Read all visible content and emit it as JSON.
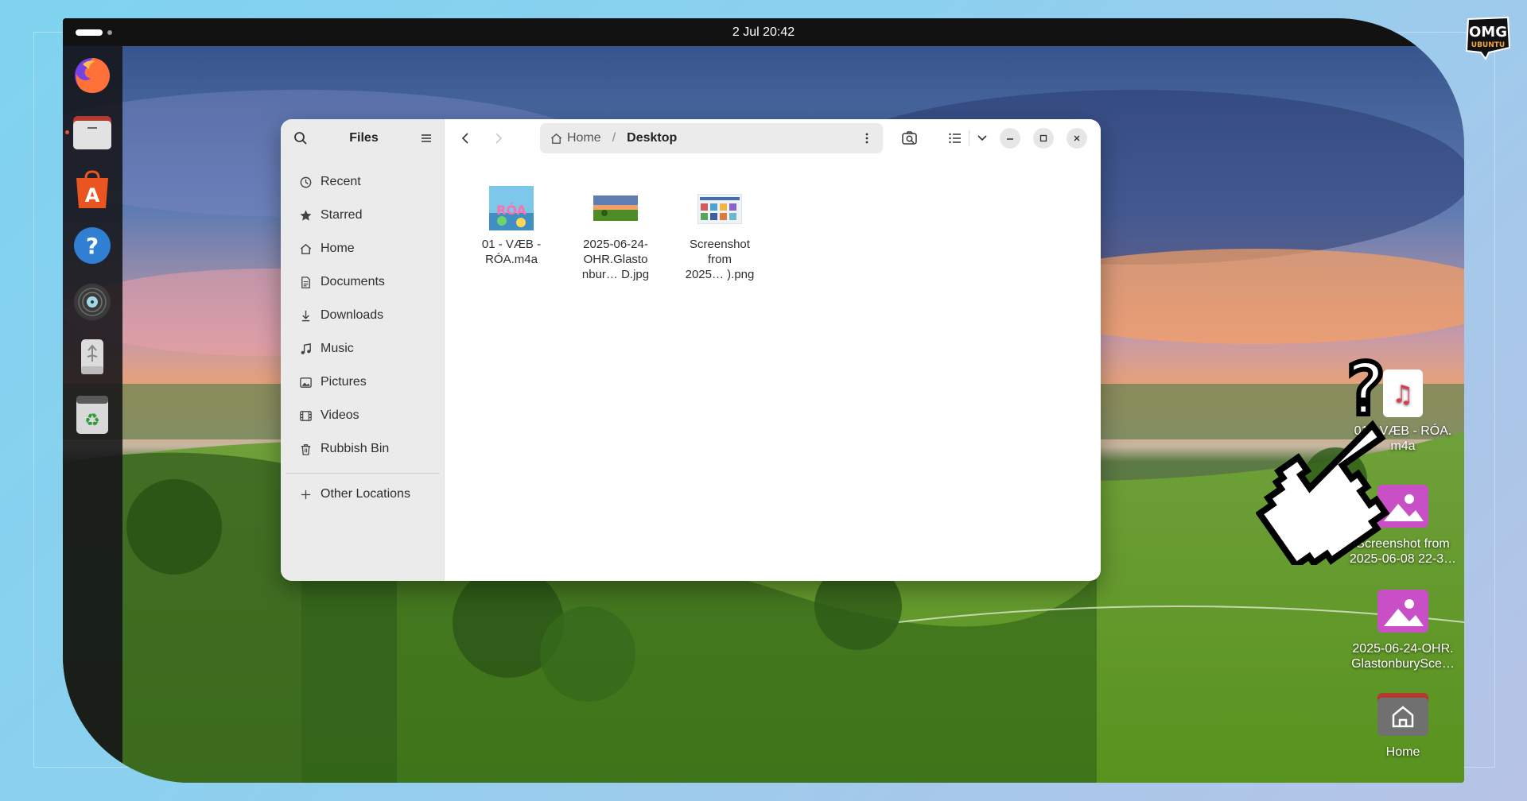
{
  "topbar": {
    "clock": "2 Jul  20:42"
  },
  "dock": {
    "items": [
      {
        "name": "firefox"
      },
      {
        "name": "files",
        "running": true
      },
      {
        "name": "app-center"
      },
      {
        "name": "help"
      },
      {
        "name": "rhythmbox"
      },
      {
        "name": "usb-drive"
      },
      {
        "name": "trash"
      }
    ]
  },
  "files_window": {
    "title": "Files",
    "sidebar": {
      "items": [
        {
          "label": "Recent",
          "icon": "clock-icon"
        },
        {
          "label": "Starred",
          "icon": "star-icon"
        },
        {
          "label": "Home",
          "icon": "home-icon"
        },
        {
          "label": "Documents",
          "icon": "document-icon"
        },
        {
          "label": "Downloads",
          "icon": "download-icon"
        },
        {
          "label": "Music",
          "icon": "music-icon"
        },
        {
          "label": "Pictures",
          "icon": "pictures-icon"
        },
        {
          "label": "Videos",
          "icon": "video-icon"
        },
        {
          "label": "Rubbish Bin",
          "icon": "trash-icon"
        }
      ],
      "other_locations": "Other Locations"
    },
    "path": {
      "home": "Home",
      "separator": "/",
      "current": "Desktop"
    },
    "files": [
      {
        "name": "01 - VÆB - RÓA.m4a",
        "line1": "01 - VÆB -",
        "line2": "RÓA.m4a",
        "line3": ""
      },
      {
        "name": "2025-06-24-OHR.Glastonbur… D.jpg",
        "line1": "2025-06-24-",
        "line2": "OHR.Glasto",
        "line3": "nbur… D.jpg"
      },
      {
        "name": "Screenshot from 2025… ).png",
        "line1": "Screenshot",
        "line2": "from",
        "line3": "2025… ).png"
      }
    ]
  },
  "desktop": {
    "icons": [
      {
        "line1": "01 - VÆB - RÓA.",
        "line2": "m4a",
        "type": "audio"
      },
      {
        "line1": "Screenshot from",
        "line2": "2025-06-08 22-3…",
        "type": "image"
      },
      {
        "line1": "2025-06-24-OHR.",
        "line2": "GlastonburySce…",
        "type": "image"
      },
      {
        "line1": "Home",
        "line2": "",
        "type": "folder"
      }
    ]
  },
  "brand": {
    "logo_top": "OMG",
    "logo_bottom": "UBUNTU"
  },
  "colors": {
    "accent": "#e95420",
    "image_icon": "#c84fc6",
    "topbar": "#121212"
  }
}
